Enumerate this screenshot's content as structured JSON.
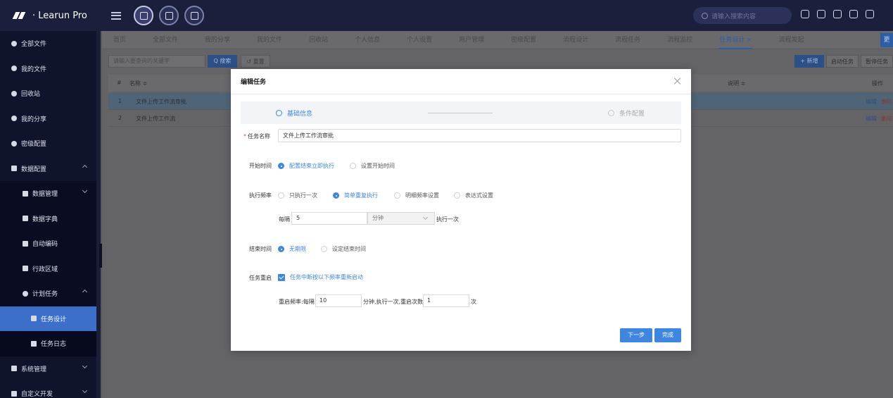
{
  "app": {
    "title": "· Learun Pro",
    "search_placeholder": "请输入搜索内容"
  },
  "sidebar": {
    "items": [
      {
        "label": "全部文件"
      },
      {
        "label": "我的文件"
      },
      {
        "label": "回收站"
      },
      {
        "label": "我的分享"
      },
      {
        "label": "密级配置"
      },
      {
        "label": "数据配置"
      },
      {
        "label": "数据管理"
      },
      {
        "label": "数据字典"
      },
      {
        "label": "自动编码"
      },
      {
        "label": "行政区域"
      },
      {
        "label": "计划任务"
      },
      {
        "label": "任务设计"
      },
      {
        "label": "任务日志"
      },
      {
        "label": "系统管理"
      },
      {
        "label": "自定义开发"
      }
    ]
  },
  "tabs": [
    "首页",
    "全部文件",
    "我的分享",
    "我的文件",
    "回收站",
    "个人信息",
    "个人设置",
    "用户管理",
    "密级配置",
    "流程设计",
    "流程任务",
    "流程监控",
    "任务设计",
    "流程发起"
  ],
  "tab_close": "×",
  "tab_more": "更",
  "toolbar": {
    "keyword_placeholder": "请输入要查询的关键字",
    "search_label": "搜索",
    "reset_label": "重置",
    "new_label": "+ 新增",
    "start_label": "启动任务",
    "pause_label": "暂停任务"
  },
  "table": {
    "headers": {
      "index": "#",
      "name": "名称 ≑",
      "desc": "说明 ≑",
      "ops": "操作"
    },
    "rows": [
      {
        "index": "1",
        "name": "文件上传工作流审批",
        "edit": "编辑",
        "del": "删除"
      },
      {
        "index": "2",
        "name": "文件上传工作流",
        "edit": "编辑",
        "del": "删除"
      }
    ]
  },
  "modal": {
    "title": "编辑任务",
    "steps": {
      "step1": "基础信息",
      "step2": "条件配置"
    },
    "task_name_label": "任务名称",
    "task_name_value": "文件上传工作流审批",
    "start_time_label": "开始时间",
    "start_options": [
      "配置结束立即执行",
      "设置开始时间"
    ],
    "frequency_label": "执行频率",
    "frequency_options": [
      "只执行一次",
      "简单重复执行",
      "明细频率设置",
      "表达式设置"
    ],
    "every_label": "每隔",
    "interval_value": "5",
    "interval_unit": "分钟",
    "execute_once": "执行一次",
    "end_time_label": "结束时间",
    "end_options": [
      "无期限",
      "设定结束时间"
    ],
    "restart_label": "任务重启",
    "restart_checkbox": "任务中断按以下频率重新启动",
    "restart_freq_label": "重启频率:每隔",
    "restart_interval": "10",
    "restart_mid_label": "分钟,执行一次,重启次数",
    "restart_count": "1",
    "restart_count_unit": "次",
    "next_button": "下一步",
    "finish_button": "完成"
  }
}
